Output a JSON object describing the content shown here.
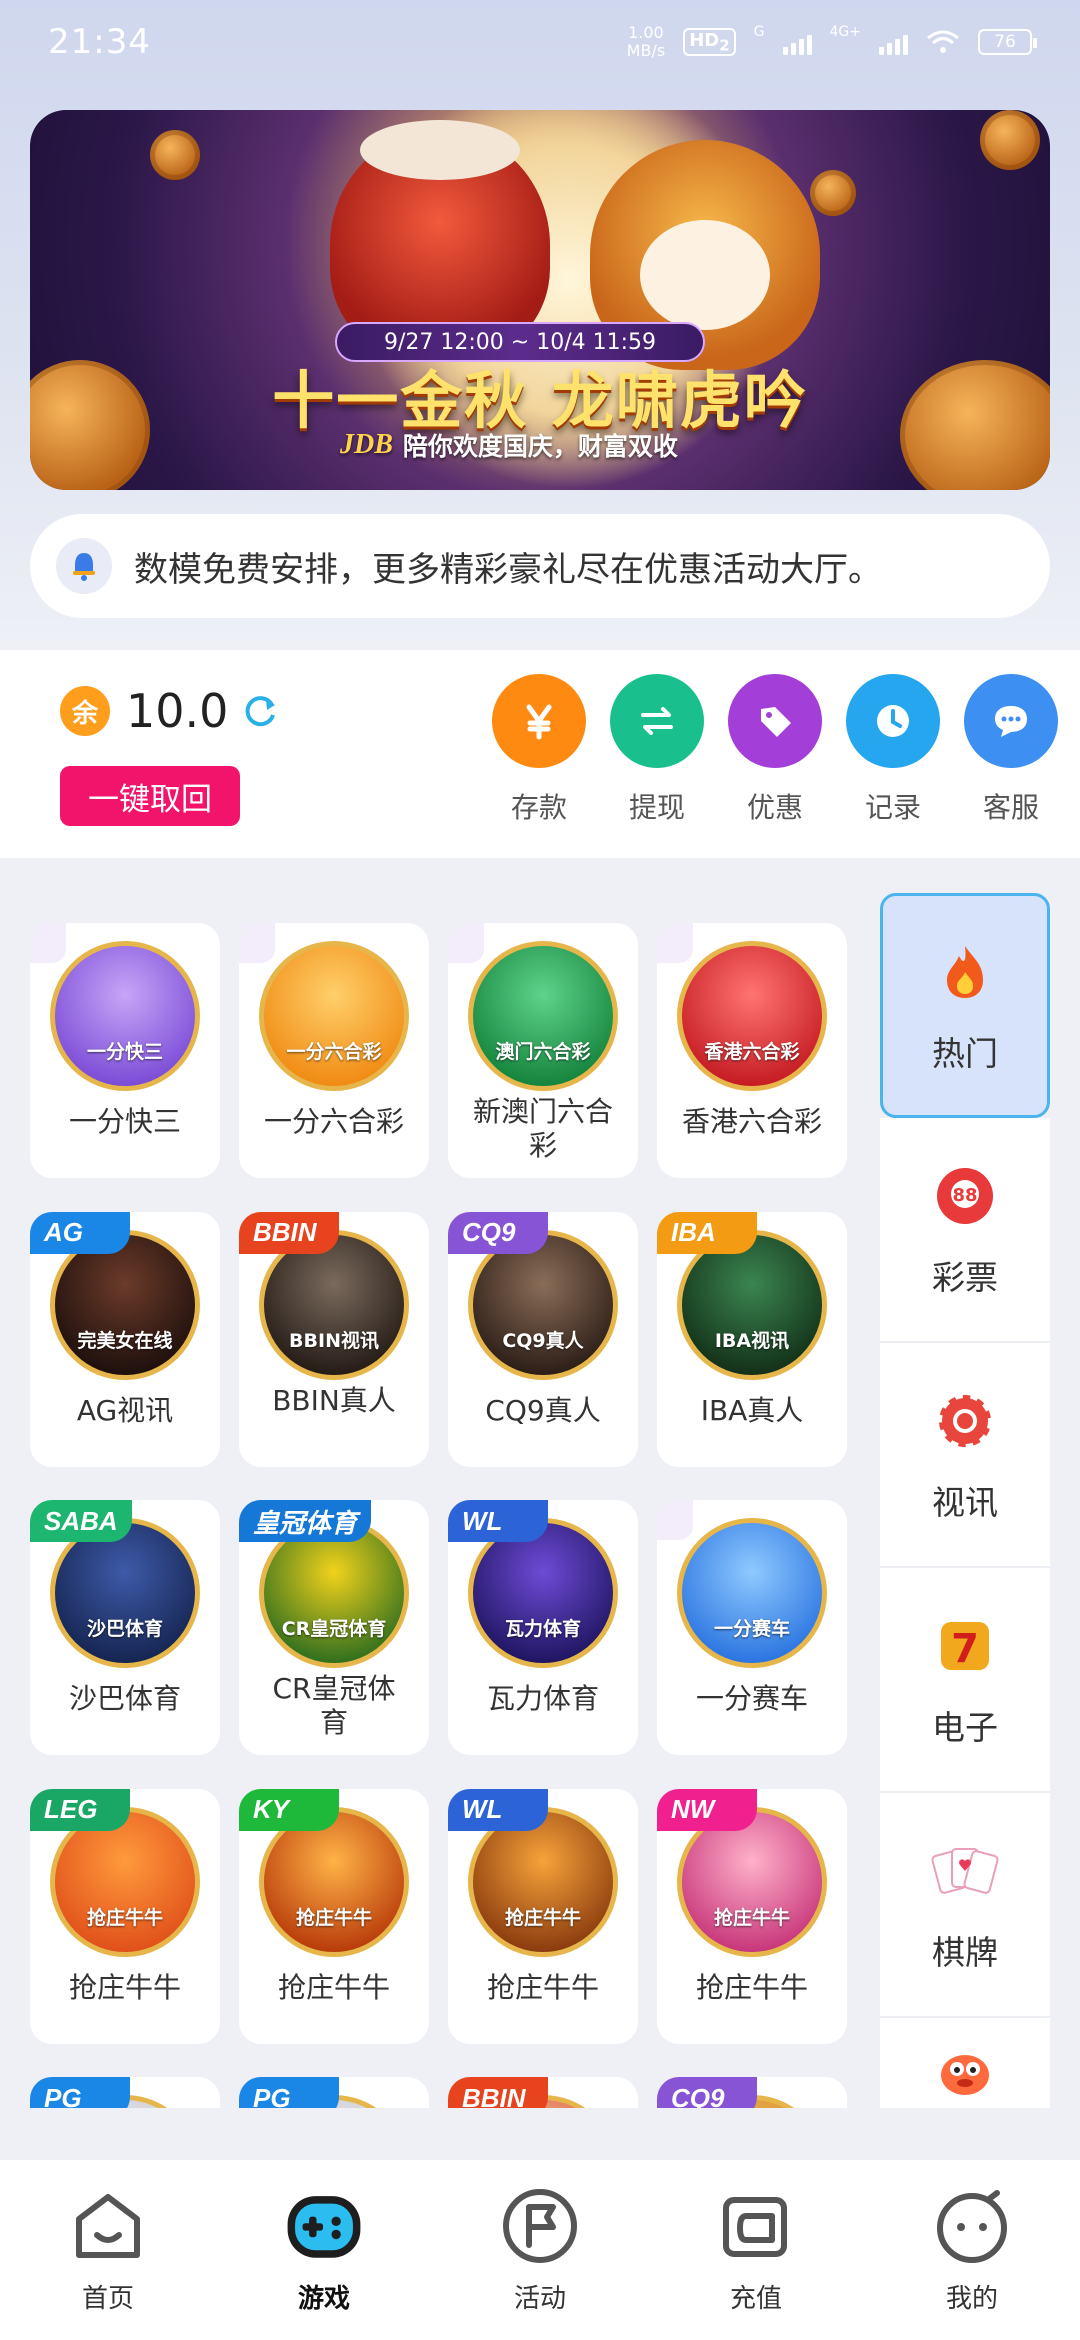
{
  "status": {
    "time": "21:34",
    "speed_value": "1.00",
    "speed_unit": "MB/s",
    "hd": "HD",
    "hd_sub": "2",
    "sig1_label": "G",
    "sig2_label": "4G+",
    "battery": "76"
  },
  "banner": {
    "date_range": "9/27 12:00 ~ 10/4 11:59",
    "title": "十一金秋 龙啸虎吟",
    "logo": "JDB",
    "subtitle": "陪你欢度国庆，财富双收",
    "slide_count": 4,
    "active_slide": 2
  },
  "marquee": {
    "text": "数模免费安排，更多精彩豪礼尽在优惠活动大厅。"
  },
  "wallet": {
    "currency_icon": "余",
    "balance": "10.0",
    "recall_label": "一键取回",
    "actions": [
      {
        "label": "存款",
        "icon": "yen-icon",
        "color": "#ff8a12"
      },
      {
        "label": "提现",
        "icon": "transfer-icon",
        "color": "#19c08e"
      },
      {
        "label": "优惠",
        "icon": "tag-icon",
        "color": "#a43ed9"
      },
      {
        "label": "记录",
        "icon": "clock-icon",
        "color": "#27a6f0"
      },
      {
        "label": "客服",
        "icon": "chat-icon",
        "color": "#3d8ff2"
      }
    ]
  },
  "games": [
    {
      "name": "一分快三",
      "badge": "",
      "circle_label": "一分快三",
      "color1": "#c7a5f7",
      "color2": "#7a4bd6"
    },
    {
      "name": "一分六合彩",
      "badge": "",
      "circle_label": "一分六合彩",
      "color1": "#ffcf6a",
      "color2": "#f08a12"
    },
    {
      "name": "新澳门六合彩",
      "badge": "",
      "circle_label": "澳门六合彩",
      "color1": "#5fd38b",
      "color2": "#14833c"
    },
    {
      "name": "香港六合彩",
      "badge": "",
      "circle_label": "香港六合彩",
      "color1": "#ff7470",
      "color2": "#c41b22"
    },
    {
      "name": "AG视讯",
      "badge": "AG",
      "badge_color": "#1a86e6",
      "circle_label": "完美女在线",
      "color1": "#6b3b2a",
      "color2": "#1d0f0c"
    },
    {
      "name": "BBIN真人",
      "badge": "BBIN",
      "badge_color": "#e8431f",
      "circle_label": "BBIN视讯",
      "color1": "#7a6a5c",
      "color2": "#241b16"
    },
    {
      "name": "CQ9真人",
      "badge": "CQ9",
      "badge_color": "#8854d6",
      "circle_label": "CQ9真人",
      "color1": "#8a6d58",
      "color2": "#2b1d16"
    },
    {
      "name": "IBA真人",
      "badge": "IBA",
      "badge_color": "#f39b12",
      "circle_label": "IBA视讯",
      "color1": "#3b8550",
      "color2": "#123018"
    },
    {
      "name": "沙巴体育",
      "badge": "SABA",
      "badge_color": "#1db670",
      "circle_label": "沙巴体育",
      "color1": "#3e5aa8",
      "color2": "#152551"
    },
    {
      "name": "CR皇冠体育",
      "badge": "皇冠体育",
      "badge_color": "#1577d6",
      "circle_label": "CR皇冠体育",
      "color1": "#f2d21b",
      "color2": "#2e6e1e"
    },
    {
      "name": "瓦力体育",
      "badge": "WL",
      "badge_color": "#2c63d6",
      "circle_label": "瓦力体育",
      "color1": "#6d4bd6",
      "color2": "#1f1560"
    },
    {
      "name": "一分赛车",
      "badge": "",
      "circle_label": "一分赛车",
      "color1": "#8fc9ff",
      "color2": "#2a74e0"
    },
    {
      "name": "抢庄牛牛",
      "badge": "LEG",
      "badge_color": "#1aa766",
      "circle_label": "抢庄牛牛",
      "color1": "#ff9a3c",
      "color2": "#e0501a"
    },
    {
      "name": "抢庄牛牛",
      "badge": "KY",
      "badge_color": "#1eb83a",
      "circle_label": "抢庄牛牛",
      "color1": "#ffb347",
      "color2": "#b83a0a"
    },
    {
      "name": "抢庄牛牛",
      "badge": "WL",
      "badge_color": "#2c63d6",
      "circle_label": "抢庄牛牛",
      "color1": "#f6a33a",
      "color2": "#8a3a0e"
    },
    {
      "name": "抢庄牛牛",
      "badge": "NW",
      "badge_color": "#f0218e",
      "circle_label": "抢庄牛牛",
      "color1": "#ffb1c9",
      "color2": "#c7357a"
    },
    {
      "name": "",
      "badge": "PG",
      "badge_color": "#1a86e6",
      "circle_label": "",
      "color1": "#e6e6ea",
      "color2": "#c8c8d0"
    },
    {
      "name": "",
      "badge": "PG",
      "badge_color": "#1a86e6",
      "circle_label": "",
      "color1": "#e6e6ea",
      "color2": "#c8c8d0"
    },
    {
      "name": "",
      "badge": "BBIN",
      "badge_color": "#e8431f",
      "circle_label": "",
      "color1": "#f7c2a6",
      "color2": "#d6522a"
    },
    {
      "name": "",
      "badge": "CQ9",
      "badge_color": "#8854d6",
      "circle_label": "",
      "color1": "#f2c46a",
      "color2": "#d17f1d"
    }
  ],
  "categories": [
    {
      "label": "热门",
      "icon": "flame-icon",
      "active": true
    },
    {
      "label": "彩票",
      "icon": "lottery-ball-icon",
      "active": false
    },
    {
      "label": "视讯",
      "icon": "chip-icon",
      "active": false
    },
    {
      "label": "电子",
      "icon": "slot-seven-icon",
      "active": false
    },
    {
      "label": "棋牌",
      "icon": "cards-icon",
      "active": false
    },
    {
      "label": "",
      "icon": "fish-icon",
      "active": false
    }
  ],
  "nav": [
    {
      "label": "首页",
      "icon": "home-icon",
      "active": false
    },
    {
      "label": "游戏",
      "icon": "gamepad-icon",
      "active": true
    },
    {
      "label": "活动",
      "icon": "flag-icon",
      "active": false
    },
    {
      "label": "充值",
      "icon": "wallet-icon",
      "active": false
    },
    {
      "label": "我的",
      "icon": "profile-face-icon",
      "active": false
    }
  ]
}
